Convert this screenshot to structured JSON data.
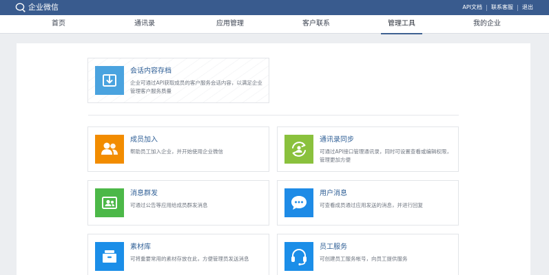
{
  "topbar": {
    "logo_text": "企业微信",
    "links": [
      "API文档",
      "联系客服",
      "退出"
    ],
    "bg_color": "#395b8e"
  },
  "nav": {
    "items": [
      {
        "label": "首页",
        "active": false
      },
      {
        "label": "通讯录",
        "active": false
      },
      {
        "label": "应用管理",
        "active": false
      },
      {
        "label": "客户联系",
        "active": false
      },
      {
        "label": "管理工具",
        "active": true
      },
      {
        "label": "我的企业",
        "active": false
      }
    ]
  },
  "tools": {
    "featured": {
      "title": "会话内容存档",
      "desc": "企业可通过API获取成员的客户服务会话内容，以满足企业管理客户服务质量",
      "icon": "archive-download-icon",
      "icon_color": "#4aa3df"
    },
    "items": [
      {
        "title": "成员加入",
        "desc": "帮助员工加入企业，并开始使用企业微信",
        "icon": "members-icon",
        "icon_color": "#f28c00"
      },
      {
        "title": "通讯录同步",
        "desc": "可通过API接口管理通讯录，同时可设置查看或编辑权限，管理更加方便",
        "icon": "sync-icon",
        "icon_color": "#8ac13d"
      },
      {
        "title": "消息群发",
        "desc": "可通过公告等应用给成员群发消息",
        "icon": "broadcast-icon",
        "icon_color": "#4cb848"
      },
      {
        "title": "用户消息",
        "desc": "可查看成员通过应用发送的消息，并进行回复",
        "icon": "chat-bubble-icon",
        "icon_color": "#1e8be6"
      },
      {
        "title": "素材库",
        "desc": "可将重要常用的素材存放在此，方便管理员发送消息",
        "icon": "material-box-icon",
        "icon_color": "#1b8ee8"
      },
      {
        "title": "员工服务",
        "desc": "可创建员工服务帐号，向员工提供服务",
        "icon": "headset-icon",
        "icon_color": "#1b8ee8"
      }
    ]
  }
}
